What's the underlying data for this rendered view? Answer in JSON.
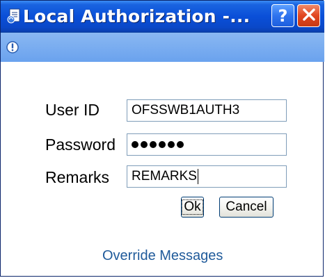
{
  "window": {
    "title": "Local Authorization -...",
    "help_glyph": "?",
    "colors": {
      "titlebar": "#0a4fd8",
      "infobar": "#7aaef0",
      "close": "#e1461f",
      "link": "#1f5a9a"
    },
    "icons": [
      "window-app-icon",
      "help-icon",
      "close-icon",
      "warning-info-icon"
    ]
  },
  "form": {
    "user_id": {
      "label": "User ID",
      "value": "OFSSWB1AUTH3"
    },
    "password": {
      "label": "Password",
      "masked_length": 6
    },
    "remarks": {
      "label": "Remarks",
      "value": "REMARKS"
    }
  },
  "buttons": {
    "ok_label": "Ok",
    "cancel_label": "Cancel"
  },
  "footer": {
    "link_label": "Override Messages"
  }
}
